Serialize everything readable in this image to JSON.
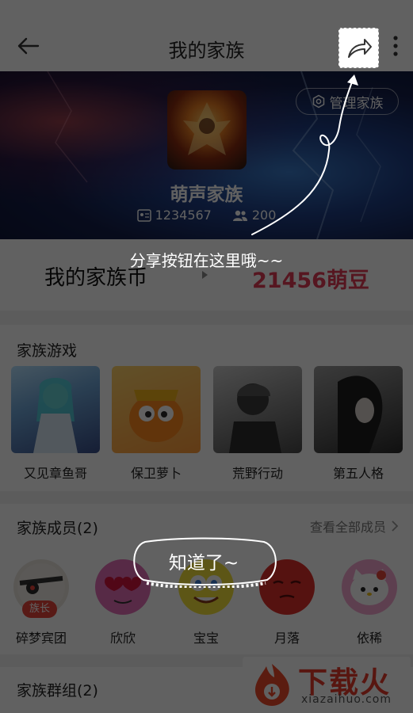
{
  "header": {
    "title": "我的家族",
    "back_icon": "back-arrow-icon",
    "share_icon": "share-icon",
    "more_icon": "more-vertical-icon"
  },
  "banner": {
    "manage_label": "管理家族",
    "family_name": "萌声家族",
    "family_id": "1234567",
    "member_count": "200"
  },
  "coins": {
    "label": "我的家族币",
    "value": "21456萌豆"
  },
  "games": {
    "title": "家族游戏",
    "items": [
      {
        "name": "又见章鱼哥",
        "icon": "game-thumb-fantasy"
      },
      {
        "name": "保卫萝卜",
        "icon": "game-thumb-carrot"
      },
      {
        "name": "荒野行动",
        "icon": "game-thumb-soldier"
      },
      {
        "name": "第五人格",
        "icon": "game-thumb-horror"
      }
    ]
  },
  "members": {
    "title": "家族成员(2)",
    "view_all": "查看全部成员",
    "leader_badge": "族长",
    "items": [
      {
        "name": "碎梦宾团"
      },
      {
        "name": "欣欣"
      },
      {
        "name": "宝宝"
      },
      {
        "name": "月落"
      },
      {
        "name": "依稀"
      }
    ]
  },
  "groups": {
    "title": "家族群组(2)"
  },
  "overlay": {
    "hint": "分享按钮在这里哦~~",
    "confirm": "知道了~"
  },
  "watermark": {
    "brand": "下载火",
    "domain": "xiazaihuo.com"
  },
  "colors": {
    "accent": "#e23a55",
    "overlay": "rgba(0,0,0,0.62)"
  }
}
